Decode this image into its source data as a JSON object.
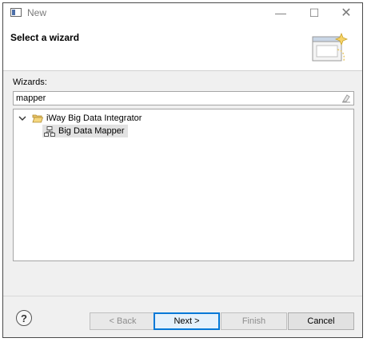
{
  "window": {
    "title": "New",
    "minimize_symbol": "—",
    "maximize_symbol": "☐",
    "close_symbol": "✕"
  },
  "banner": {
    "title": "Select a wizard",
    "image_icon": "wizard-banner-icon"
  },
  "wizards": {
    "label": "Wizards:",
    "filter_value": "mapper",
    "tree": {
      "category": {
        "label": "iWay Big Data Integrator",
        "expanded": true,
        "icon": "folder-open-icon"
      },
      "item": {
        "label": "Big Data Mapper",
        "selected": true,
        "icon": "mapper-icon"
      }
    }
  },
  "buttons": {
    "help_symbol": "?",
    "back": "< Back",
    "next": "Next >",
    "finish": "Finish",
    "cancel": "Cancel"
  },
  "colors": {
    "default_button_border": "#0078d7",
    "selection_bg": "#e2e2e2",
    "dialog_bg": "#f0f0f0"
  }
}
